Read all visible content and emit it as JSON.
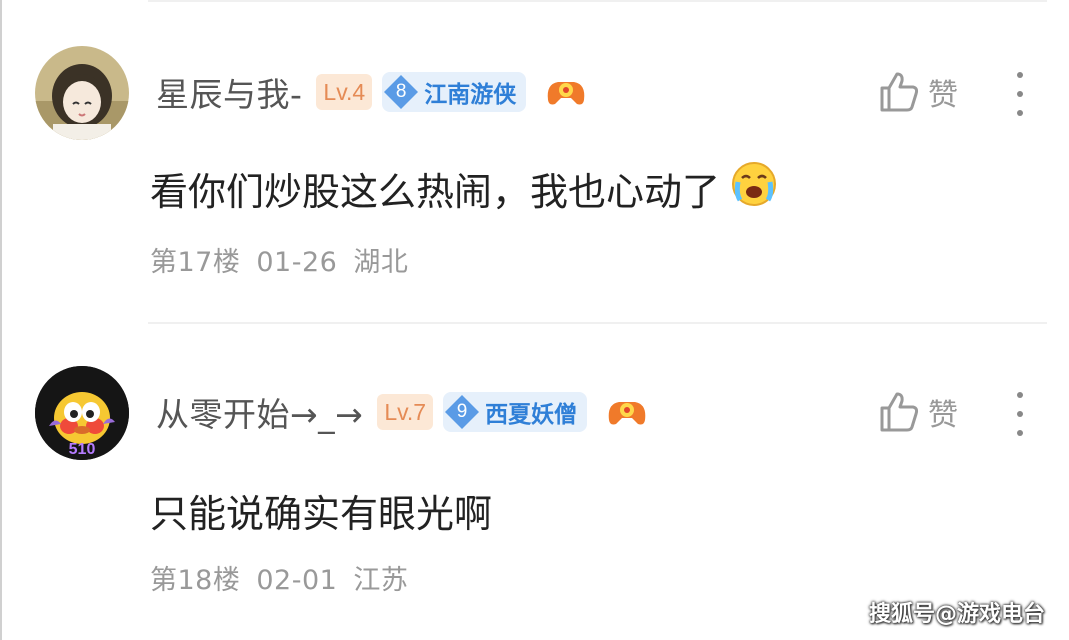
{
  "comments": [
    {
      "username": "星辰与我-",
      "level": "Lv.4",
      "title_number": "8",
      "title_name": "江南游侠",
      "game_icon": "gamepad-icon",
      "like_label": "赞",
      "text": "看你们炒股这么热闹，我也心动了",
      "text_emoji": "crying-face-emoji",
      "floor": "第17楼",
      "date": "01-26",
      "location": "湖北"
    },
    {
      "username": "从零开始→_→",
      "level": "Lv.7",
      "title_number": "9",
      "title_name": "西夏妖僧",
      "game_icon": "gamepad-icon",
      "like_label": "赞",
      "text": "只能说确实有眼光啊",
      "floor": "第18楼",
      "date": "02-01",
      "location": "江苏"
    }
  ],
  "watermark": "搜狐号@游戏电台",
  "colors": {
    "level_badge_bg": "#fce8d6",
    "level_badge_text": "#e58b55",
    "title_badge_bg": "#e6f0fb",
    "title_badge_text": "#2f7fd7"
  }
}
